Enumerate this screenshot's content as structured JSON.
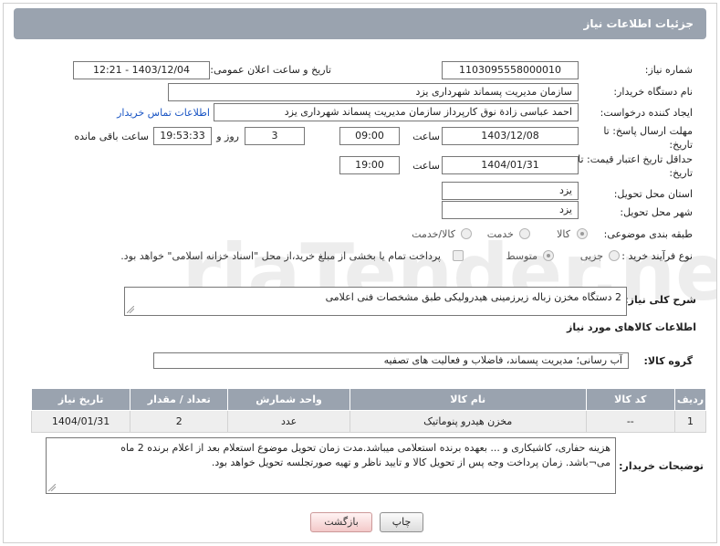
{
  "header": {
    "title": "جزئیات اطلاعات نیاز"
  },
  "form": {
    "need_number_label": "شماره نیاز:",
    "need_number": "1103095558000010",
    "announce_label": "تاریخ و ساعت اعلان عمومی:",
    "announce_value": "1403/12/04 - 12:21",
    "buyer_org_label": "نام دستگاه خریدار:",
    "buyer_org": "سازمان مدیریت پسماند شهرداری یزد",
    "creator_label": "ایجاد کننده درخواست:",
    "creator": "احمد عباسی زادة نوق کارپرداز سازمان مدیریت پسماند شهرداری یزد",
    "buyer_contact_link": "اطلاعات تماس خریدار",
    "reply_deadline_label": "مهلت ارسال پاسخ: تا تاریخ:",
    "reply_date": "1403/12/08",
    "time_word": "ساعت",
    "reply_time": "09:00",
    "days_value": "3",
    "days_word": "روز و",
    "remaining_time": "19:53:33",
    "remaining_word": "ساعت باقی مانده",
    "price_validity_label": "حداقل تاریخ اعتبار قیمت: تا تاریخ:",
    "price_date": "1404/01/31",
    "price_time": "19:00",
    "province_label": "استان محل تحویل:",
    "province": "یزد",
    "city_label": "شهر محل تحویل:",
    "city": "یزد",
    "category_label": "طبقه بندی موضوعی:",
    "category_options": [
      "کالا",
      "خدمت",
      "کالا/خدمت"
    ],
    "process_label": "نوع فرآیند خرید :",
    "process_options": [
      "جزیی",
      "متوسط"
    ],
    "payment_note": "پرداخت تمام یا بخشی از مبلغ خرید،از محل \"اسناد خزانه اسلامی\" خواهد بود."
  },
  "description": {
    "label": "شرح کلی نیاز:",
    "text": "2 دستگاه مخزن زباله زیرزمینی  هیدرولیکی طبق مشخصات فنی اعلامی"
  },
  "goods_section": {
    "title": "اطلاعات کالاهای مورد نیاز",
    "group_label": "گروه کالا:",
    "group_value": "آب رسانی؛ مدیریت پسماند، فاضلاب و فعالیت های تصفیه"
  },
  "table": {
    "headers": [
      "ردیف",
      "کد کالا",
      "نام کالا",
      "واحد شمارش",
      "تعداد / مقدار",
      "تاریخ نیاز"
    ],
    "rows": [
      [
        "1",
        "--",
        "مخزن هیدرو پنوماتیک",
        "عدد",
        "2",
        "1404/01/31"
      ]
    ]
  },
  "buyer_notes": {
    "label": "توضیحات خریدار:",
    "line1": "هزینه حفاری، کاشیکاری و ... بعهده برنده استعلامی میباشد.مدت زمان تحویل موضوع استعلام بعد از اعلام برنده  2 ماه",
    "line2": "می¬باشد. زمان پرداخت وجه پس از تحویل کالا و تایید ناظر و تهیه صورتجلسه تحویل خواهد بود."
  },
  "buttons": {
    "print": "چاپ",
    "back": "بازگشت"
  },
  "watermark": {
    "text": "AriaTender.neT"
  }
}
